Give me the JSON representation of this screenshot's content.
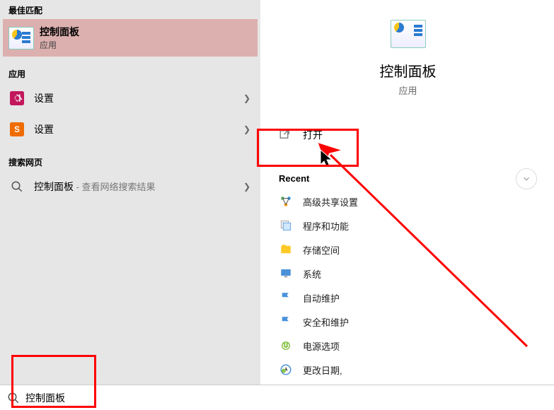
{
  "left": {
    "best_match_header": "最佳匹配",
    "best_match": {
      "title": "控制面板",
      "subtitle": "应用"
    },
    "apps_header": "应用",
    "apps": [
      {
        "label": "设置",
        "icon": "settings-magenta"
      },
      {
        "label": "设置",
        "icon": "settings-orange"
      }
    ],
    "web_header": "搜索网页",
    "web": {
      "label": "控制面板",
      "suffix": " - 查看网络搜索结果"
    }
  },
  "right": {
    "title": "控制面板",
    "subtitle": "应用",
    "open_label": "打开",
    "recent_header": "Recent",
    "recent": [
      {
        "label": "高级共享设置",
        "icon": "network"
      },
      {
        "label": "程序和功能",
        "icon": "programs"
      },
      {
        "label": "存储空间",
        "icon": "folder"
      },
      {
        "label": "系统",
        "icon": "monitor"
      },
      {
        "label": "自动维护",
        "icon": "flag"
      },
      {
        "label": "安全和维护",
        "icon": "flag"
      },
      {
        "label": "电源选项",
        "icon": "power"
      },
      {
        "label": "更改日期,",
        "icon": "clock"
      }
    ]
  },
  "search": {
    "value": "控制面板"
  }
}
